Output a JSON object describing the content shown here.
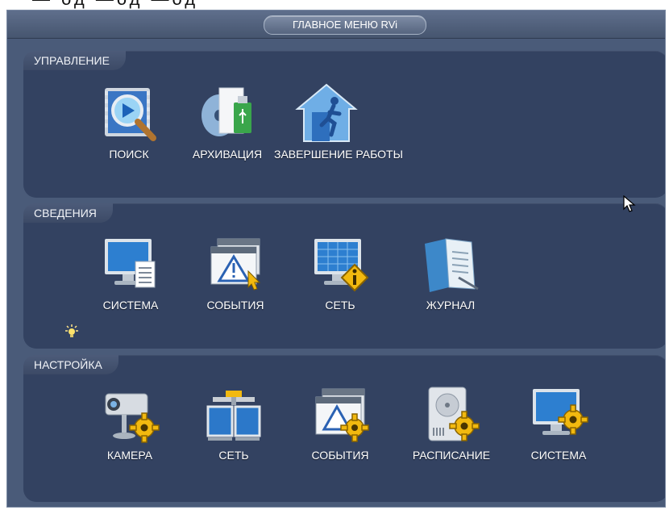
{
  "window": {
    "title": "ГЛАВНОЕ МЕНЮ RVi"
  },
  "top_overlay_text": "— од  —од  —од ",
  "sections": [
    {
      "label": "УПРАВЛЕНИЕ",
      "items": [
        {
          "label": "ПОИСК",
          "icon": "search-video-icon"
        },
        {
          "label": "АРХИВАЦИЯ",
          "icon": "backup-usb-icon"
        },
        {
          "label": "ЗАВЕРШЕНИЕ РАБОТЫ",
          "icon": "shutdown-exit-icon"
        }
      ]
    },
    {
      "label": "СВЕДЕНИЯ",
      "items": [
        {
          "label": "СИСТЕМА",
          "icon": "system-info-icon"
        },
        {
          "label": "СОБЫТИЯ",
          "icon": "events-warning-icon"
        },
        {
          "label": "СЕТЬ",
          "icon": "network-info-icon"
        },
        {
          "label": "ЖУРНАЛ",
          "icon": "log-book-icon"
        }
      ]
    },
    {
      "label": "НАСТРОЙКА",
      "items": [
        {
          "label": "КАМЕРА",
          "icon": "camera-settings-icon"
        },
        {
          "label": "СЕТЬ",
          "icon": "network-settings-icon"
        },
        {
          "label": "СОБЫТИЯ",
          "icon": "events-settings-icon"
        },
        {
          "label": "РАСПИСАНИЕ",
          "icon": "schedule-settings-icon"
        },
        {
          "label": "СИСТЕМА",
          "icon": "system-settings-icon"
        }
      ]
    }
  ],
  "colors": {
    "background": "#4a5b79",
    "section": "#334261",
    "text": "#ffffff",
    "gear": "#f2b90f"
  }
}
